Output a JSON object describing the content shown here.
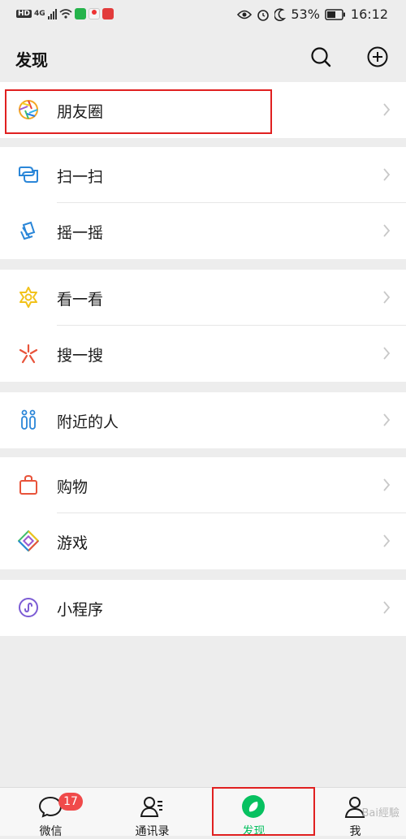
{
  "status_bar": {
    "left_tags": [
      "HD",
      "4G"
    ],
    "battery_percent": "53%",
    "time": "16:12",
    "icons": [
      "eye-icon",
      "alarm-icon",
      "moon-icon",
      "battery-icon"
    ]
  },
  "header": {
    "title": "发现",
    "search_icon": "search-icon",
    "add_icon": "plus-circle-icon"
  },
  "groups": [
    {
      "items": [
        {
          "label": "朋友圈",
          "icon": "moments-aperture-icon",
          "highlighted": true
        }
      ]
    },
    {
      "items": [
        {
          "label": "扫一扫",
          "icon": "scan-icon"
        },
        {
          "label": "摇一摇",
          "icon": "shake-icon"
        }
      ]
    },
    {
      "items": [
        {
          "label": "看一看",
          "icon": "top-stories-icon"
        },
        {
          "label": "搜一搜",
          "icon": "search-spark-icon"
        }
      ]
    },
    {
      "items": [
        {
          "label": "附近的人",
          "icon": "people-nearby-icon"
        }
      ]
    },
    {
      "items": [
        {
          "label": "购物",
          "icon": "shopping-bag-icon"
        },
        {
          "label": "游戏",
          "icon": "games-icon"
        }
      ]
    },
    {
      "items": [
        {
          "label": "小程序",
          "icon": "mini-program-icon"
        }
      ]
    }
  ],
  "tabbar": {
    "tabs": [
      {
        "label": "微信",
        "icon": "chat-bubble-icon",
        "badge": "17"
      },
      {
        "label": "通讯录",
        "icon": "contacts-icon"
      },
      {
        "label": "发现",
        "icon": "compass-icon",
        "active": true
      },
      {
        "label": "我",
        "icon": "me-person-icon"
      }
    ]
  },
  "colors": {
    "accent": "#07c160",
    "badge": "#f04a4a",
    "highlight_box": "#e02020",
    "background": "#ededed"
  },
  "watermark": "Bai經驗"
}
